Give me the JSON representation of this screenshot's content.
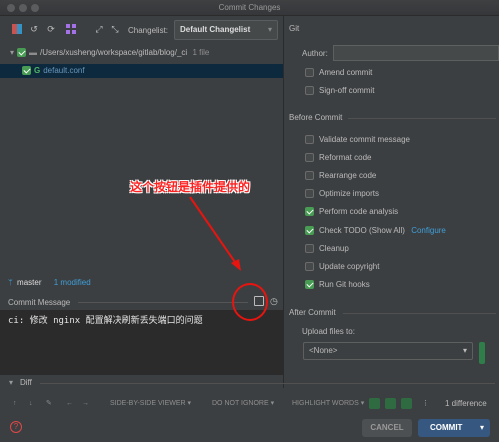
{
  "window": {
    "title": "Commit Changes"
  },
  "toolbar": {
    "changelist_label": "Changelist:",
    "changelist_value": "Default Changelist",
    "icons": [
      "diff-icon",
      "revert-icon",
      "refresh-icon",
      "group-icon",
      "expand-icon",
      "collapse-icon"
    ]
  },
  "tree": {
    "root_path": "/Users/xusheng/workspace/gitlab/blog/_ci",
    "root_count": "1 file",
    "file_name": "default.conf",
    "file_letter": "G"
  },
  "status": {
    "branch": "master",
    "modified": "1 modified"
  },
  "commit_message": {
    "label": "Commit Message",
    "text": "ci: 修改 nginx 配置解决刷新丢失端口的问题"
  },
  "annotation": {
    "text": "这个按钮是插件提供的"
  },
  "git": {
    "section": "Git",
    "author_label": "Author:",
    "author_value": "",
    "options": [
      {
        "label": "Amend commit",
        "checked": false
      },
      {
        "label": "Sign-off commit",
        "checked": false
      }
    ]
  },
  "before_commit": {
    "section": "Before Commit",
    "options": [
      {
        "label": "Validate commit message",
        "checked": false
      },
      {
        "label": "Reformat code",
        "checked": false
      },
      {
        "label": "Rearrange code",
        "checked": false
      },
      {
        "label": "Optimize imports",
        "checked": false
      },
      {
        "label": "Perform code analysis",
        "checked": true
      },
      {
        "label": "Check TODO (Show All)",
        "checked": true,
        "link": "Configure"
      },
      {
        "label": "Cleanup",
        "checked": false
      },
      {
        "label": "Update copyright",
        "checked": false
      },
      {
        "label": "Run Git hooks",
        "checked": true
      }
    ]
  },
  "after_commit": {
    "section": "After Commit",
    "upload_label": "Upload files to:",
    "upload_value": "<None>"
  },
  "diff": {
    "label": "Diff",
    "viewer": "SIDE-BY-SIDE VIEWER",
    "ignore": "DO NOT IGNORE",
    "highlight": "HIGHLIGHT WORDS",
    "count": "1 difference"
  },
  "buttons": {
    "cancel": "CANCEL",
    "commit": "COMMIT"
  },
  "colors": {
    "accent": "#365880",
    "check": "#499c54",
    "annotation": "#e8140f",
    "link": "#3f9ed8"
  }
}
